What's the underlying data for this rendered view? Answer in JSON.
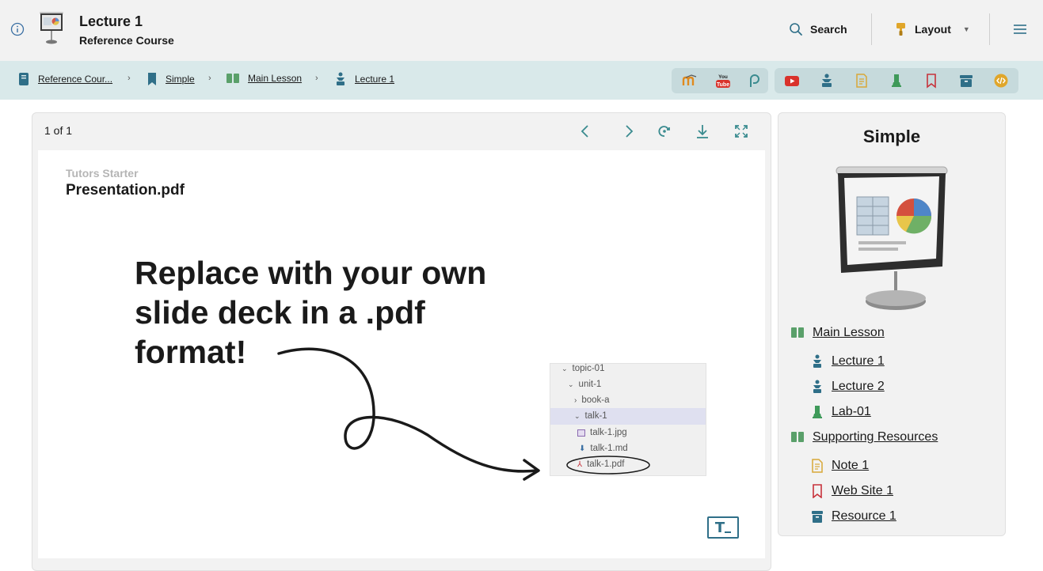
{
  "header": {
    "title": "Lecture 1",
    "subtitle": "Reference Course",
    "search_label": "Search",
    "layout_label": "Layout"
  },
  "breadcrumbs": [
    {
      "label": "Reference Cour...",
      "icon": "course-icon"
    },
    {
      "label": "Simple",
      "icon": "bookmark-icon"
    },
    {
      "label": "Main Lesson",
      "icon": "lesson-icon"
    },
    {
      "label": "Lecture 1",
      "icon": "lecture-icon"
    }
  ],
  "toolbar": {
    "group1": [
      "moodle-icon",
      "youtube-icon",
      "slack-icon"
    ],
    "group2": [
      "video-icon",
      "lecture-icon",
      "note-icon",
      "lab-icon",
      "web-bookmark-icon",
      "archive-icon",
      "code-icon"
    ]
  },
  "viewer": {
    "page_count": "1 of 1",
    "slide": {
      "kicker": "Tutors Starter",
      "title": "Presentation.pdf",
      "lines": [
        "Replace with your own",
        "slide deck in a .pdf",
        "format!"
      ],
      "tree": [
        "topic-01",
        "unit-1",
        "book-a",
        "talk-1",
        "talk-1.jpg",
        "talk-1.md",
        "talk-1.pdf"
      ],
      "badge": "T"
    }
  },
  "sidebar": {
    "title": "Simple",
    "items": [
      {
        "label": "Main Lesson",
        "type": "lesson"
      },
      {
        "label": "Lecture 1",
        "type": "lecture"
      },
      {
        "label": "Lecture 2",
        "type": "lecture"
      },
      {
        "label": "Lab-01",
        "type": "lab"
      },
      {
        "label": "Supporting Resources",
        "type": "lesson"
      },
      {
        "label": "Note 1",
        "type": "note"
      },
      {
        "label": "Web Site 1",
        "type": "web"
      },
      {
        "label": "Resource 1",
        "type": "archive"
      }
    ]
  },
  "colors": {
    "accent_teal": "#3a8b8f",
    "lesson_green": "#5aa06a",
    "lab_green": "#3f9a5a",
    "note_yellow": "#d8a838",
    "web_red": "#c7323b",
    "archive_blue": "#2f6f88"
  }
}
